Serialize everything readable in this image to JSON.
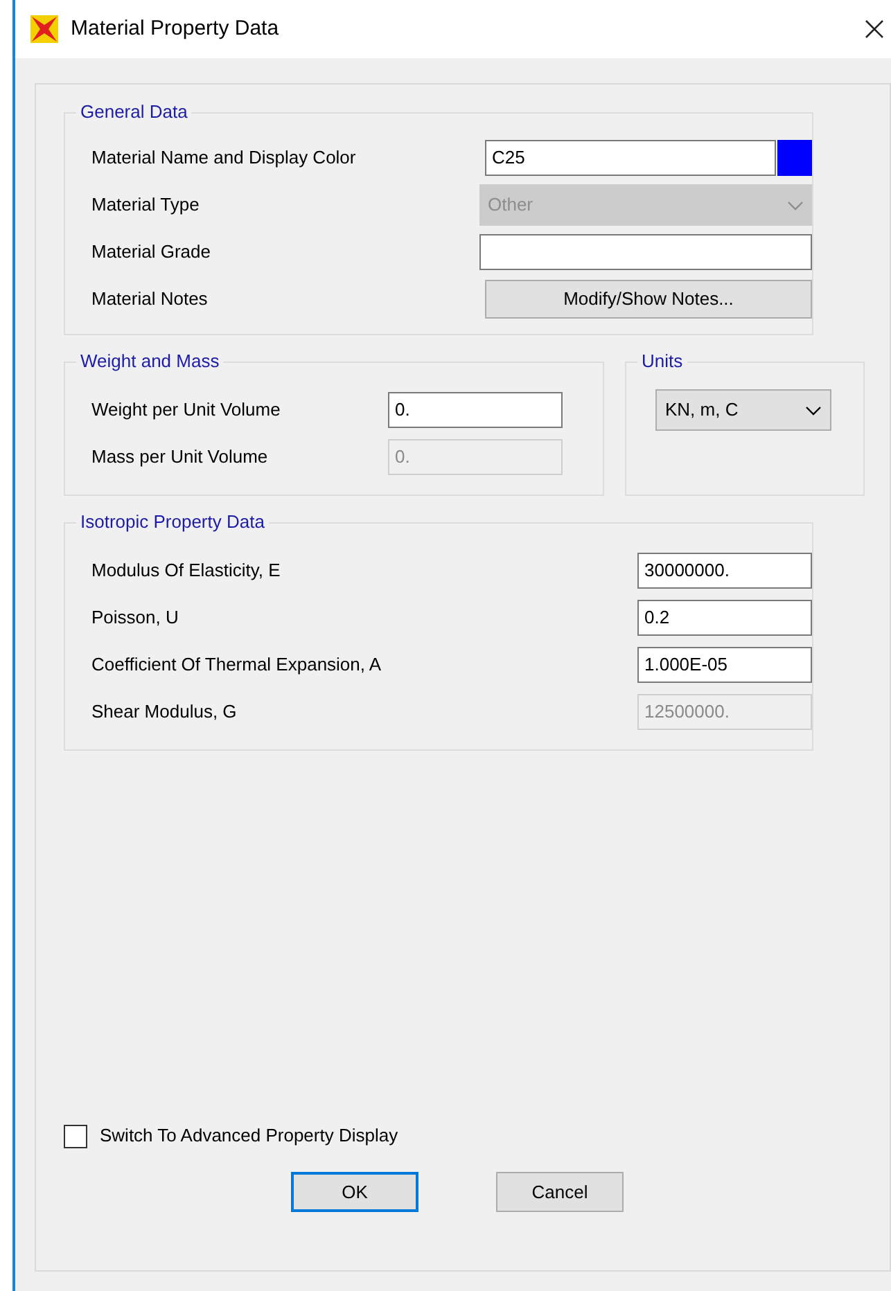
{
  "window": {
    "title": "Material Property Data"
  },
  "general": {
    "title": "General Data",
    "rows": [
      {
        "kind": "name_color",
        "label": "Material Name and Display Color",
        "value": "C25",
        "color": "#0000ff"
      },
      {
        "kind": "combo",
        "label": "Material Type",
        "value": "Other",
        "disabled": true
      },
      {
        "kind": "text",
        "label": "Material Grade",
        "disabled": false
      },
      {
        "kind": "button",
        "label": "Material Notes",
        "button": "Modify/Show Notes..."
      }
    ]
  },
  "weight": {
    "title": "Weight and Mass",
    "rows": [
      {
        "kind": "text",
        "label": "Weight per Unit Volume",
        "value": "0.",
        "disabled": false
      },
      {
        "kind": "text",
        "label": "Mass per Unit Volume",
        "value": "0.",
        "disabled": true
      }
    ]
  },
  "units": {
    "title": "Units",
    "value": "KN, m, C"
  },
  "isotropic": {
    "title": "Isotropic Property Data",
    "rows": [
      {
        "kind": "text",
        "label": "Modulus Of Elasticity,  E",
        "value": "30000000.",
        "disabled": false
      },
      {
        "kind": "text",
        "label": "Poisson, U",
        "value": "0.2",
        "disabled": false
      },
      {
        "kind": "text",
        "label": "Coefficient Of Thermal Expansion,  A",
        "value": "1.000E-05",
        "disabled": false
      },
      {
        "kind": "text",
        "label": "Shear Modulus,  G",
        "value": "12500000.",
        "disabled": true
      }
    ]
  },
  "advanced": {
    "label": "Switch To Advanced Property Display",
    "checked": false
  },
  "buttons": [
    {
      "label": "OK",
      "default": true
    },
    {
      "label": "Cancel",
      "default": false
    }
  ]
}
